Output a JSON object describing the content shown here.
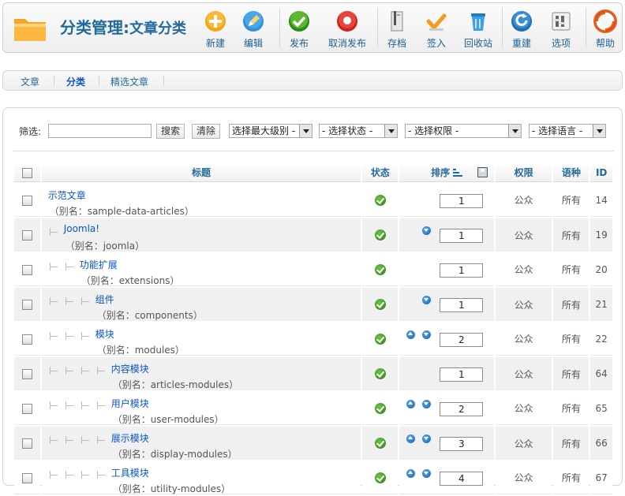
{
  "header": {
    "title": "分类管理:",
    "subtitle": "文章分类",
    "buttons": [
      {
        "name": "new",
        "label": "新建",
        "icon": "plus-circle-icon"
      },
      {
        "name": "edit",
        "label": "编辑",
        "icon": "pencil-icon"
      },
      {
        "name": "publish",
        "label": "发布",
        "icon": "check-circle-icon"
      },
      {
        "name": "unpublish",
        "label": "取消发布",
        "icon": "stop-circle-icon"
      },
      {
        "name": "archive",
        "label": "存档",
        "icon": "archive-icon"
      },
      {
        "name": "checkin",
        "label": "签入",
        "icon": "checkmark-icon"
      },
      {
        "name": "trash",
        "label": "回收站",
        "icon": "trash-icon"
      },
      {
        "name": "rebuild",
        "label": "重建",
        "icon": "refresh-icon"
      },
      {
        "name": "options",
        "label": "选项",
        "icon": "options-icon"
      },
      {
        "name": "help",
        "label": "帮助",
        "icon": "lifebuoy-icon"
      }
    ]
  },
  "submenu": {
    "items": [
      {
        "label": "文章",
        "active": false
      },
      {
        "label": "分类",
        "active": true
      },
      {
        "label": "精选文章",
        "active": false
      }
    ]
  },
  "filters": {
    "label": "筛选:",
    "search_value": "",
    "search_button": "搜索",
    "clear_button": "清除",
    "level_select": "选择最大级别 -",
    "state_select": "- 选择状态 -",
    "access_select": "- 选择权限 -",
    "language_select": "- 选择语言 -"
  },
  "table": {
    "columns": {
      "title": "标题",
      "status": "状态",
      "ordering": "排序",
      "access": "权限",
      "language": "语种",
      "id": "ID"
    },
    "rows": [
      {
        "name": "示范文章",
        "alias": "（别名：sample-data-articles）",
        "level": 1,
        "order": "1",
        "up": false,
        "down": false,
        "access": "公众",
        "language": "所有",
        "id": "14"
      },
      {
        "name": "Joomla!",
        "alias": "（别名：joomla）",
        "level": 2,
        "order": "1",
        "up": false,
        "down": true,
        "access": "公众",
        "language": "所有",
        "id": "19"
      },
      {
        "name": "功能扩展",
        "alias": "（别名：extensions）",
        "level": 3,
        "order": "1",
        "up": false,
        "down": false,
        "access": "公众",
        "language": "所有",
        "id": "20"
      },
      {
        "name": "组件",
        "alias": "（别名：components）",
        "level": 4,
        "order": "1",
        "up": false,
        "down": true,
        "access": "公众",
        "language": "所有",
        "id": "21"
      },
      {
        "name": "模块",
        "alias": "（别名：modules）",
        "level": 4,
        "order": "2",
        "up": true,
        "down": true,
        "access": "公众",
        "language": "所有",
        "id": "22"
      },
      {
        "name": "内容模块",
        "alias": "（别名：articles-modules）",
        "level": 5,
        "order": "1",
        "up": false,
        "down": false,
        "access": "公众",
        "language": "所有",
        "id": "64"
      },
      {
        "name": "用户模块",
        "alias": "（别名：user-modules）",
        "level": 5,
        "order": "2",
        "up": true,
        "down": true,
        "access": "公众",
        "language": "所有",
        "id": "65"
      },
      {
        "name": "展示模块",
        "alias": "（别名：display-modules）",
        "level": 5,
        "order": "3",
        "up": true,
        "down": true,
        "access": "公众",
        "language": "所有",
        "id": "66"
      },
      {
        "name": "工具模块",
        "alias": "（别名：utility-modules）",
        "level": 5,
        "order": "4",
        "up": true,
        "down": true,
        "access": "公众",
        "language": "所有",
        "id": "67"
      }
    ]
  }
}
